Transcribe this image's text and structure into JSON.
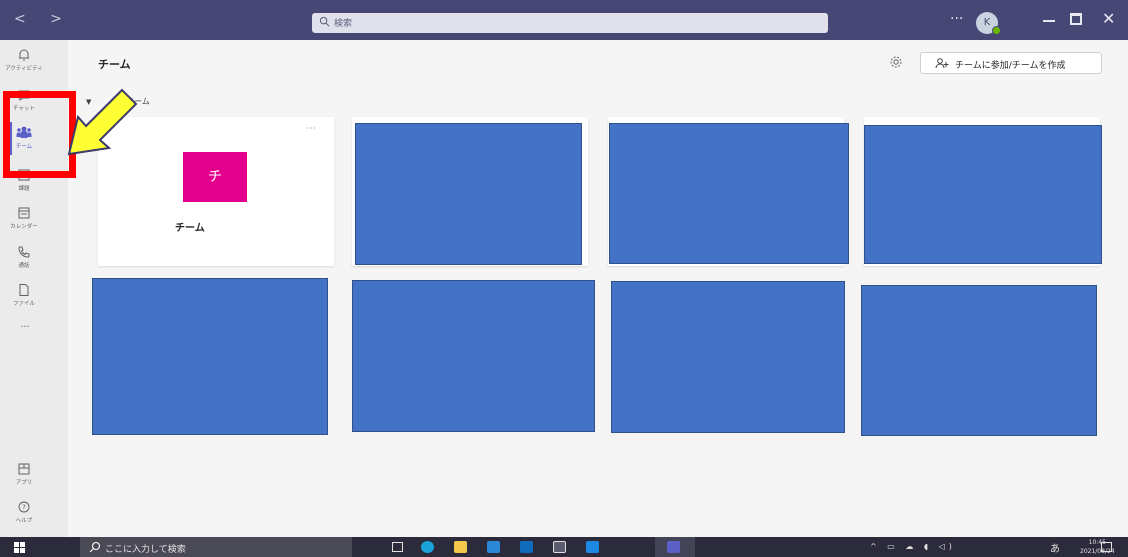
{
  "titlebar": {
    "nav": "<   >",
    "search_placeholder": "検索",
    "more": "···",
    "avatar_initial": "K",
    "close": "✕"
  },
  "rail": {
    "items": [
      {
        "label": "アクティビティ",
        "icon": "bell-icon"
      },
      {
        "label": "チャット",
        "icon": "chat-icon"
      },
      {
        "label": "チーム",
        "icon": "teams-icon"
      },
      {
        "label": "課題",
        "icon": "assignments-icon"
      },
      {
        "label": "カレンダー",
        "icon": "calendar-icon"
      },
      {
        "label": "通話",
        "icon": "phone-icon"
      },
      {
        "label": "ファイル",
        "icon": "file-icon"
      }
    ],
    "more": "···",
    "bottom": [
      {
        "label": "アプリ",
        "icon": "apps-icon"
      },
      {
        "label": "ヘルプ",
        "icon": "help-icon"
      }
    ]
  },
  "main": {
    "title": "チーム",
    "join_button": "チームに参加/チームを作成",
    "section_label": "のチーム",
    "team_card": {
      "avatar_letter": "チ",
      "name": "チーム",
      "more": "···"
    }
  },
  "taskbar": {
    "search_placeholder": "ここに入力して検索",
    "tray": "^  ▭  ☁  ◖  ◁)",
    "ime": "あ",
    "time": "10:45",
    "date": "2021/08/24"
  },
  "colors": {
    "titlebar": "#464775",
    "rail_bg": "#ebebeb",
    "accent": "#5b5fc7",
    "team_avatar": "#e3008c",
    "redaction_blue": "#4472c4",
    "highlight_red": "#ff0000",
    "arrow_yellow": "#ffff00"
  }
}
